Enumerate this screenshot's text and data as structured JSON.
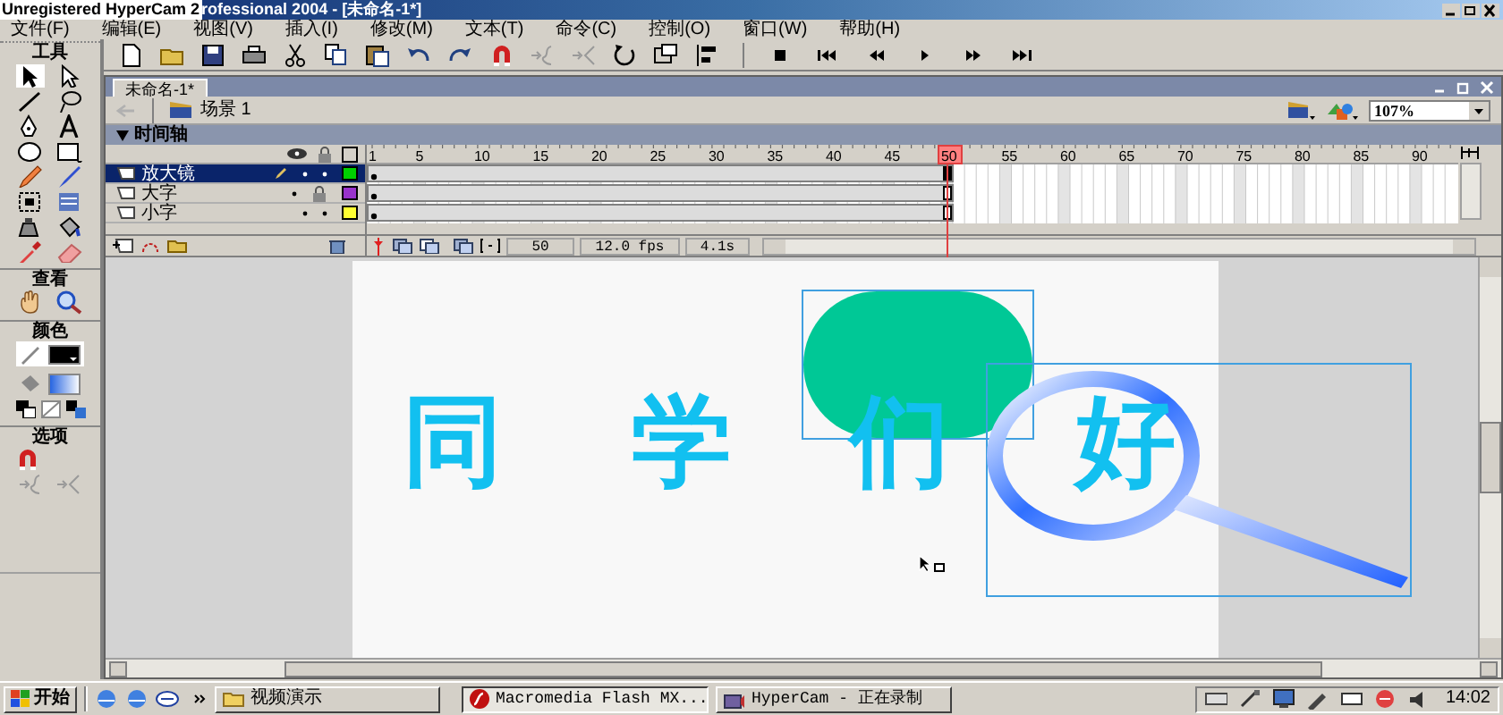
{
  "title_bar": {
    "watermark": "Unregistered HyperCam 2",
    "title": "rofessional 2004 - [未命名-1*]"
  },
  "menu": [
    "文件(F)",
    "编辑(E)",
    "视图(V)",
    "插入(I)",
    "修改(M)",
    "文本(T)",
    "命令(C)",
    "控制(O)",
    "窗口(W)",
    "帮助(H)"
  ],
  "tools_panel": {
    "title": "工具",
    "view_title": "查看",
    "colors_title": "颜色",
    "options_title": "选项"
  },
  "document": {
    "tab": "未命名-1*",
    "scene": "场景 1",
    "zoom": "107%"
  },
  "timeline": {
    "title": "时间轴",
    "ruler": [
      "1",
      "5",
      "10",
      "15",
      "20",
      "25",
      "30",
      "35",
      "40",
      "45",
      "50",
      "55",
      "60",
      "65",
      "70",
      "75",
      "80",
      "85",
      "90"
    ],
    "layers": [
      {
        "name": "放大镜",
        "selected": true,
        "locked": false,
        "color": "#00d000"
      },
      {
        "name": "大字",
        "selected": false,
        "locked": true,
        "color": "#9933cc"
      },
      {
        "name": "小字",
        "selected": false,
        "locked": false,
        "color": "#ffff33"
      }
    ],
    "current_frame": "50",
    "frame_rate": "12.0 fps",
    "elapsed": "4.1s"
  },
  "stage": {
    "words": [
      "同",
      "学",
      "们",
      "好"
    ]
  },
  "taskbar": {
    "start": "开始",
    "items": [
      {
        "label": "视频演示",
        "selected": false,
        "kind": "folder"
      },
      {
        "label": "Macromedia Flash MX...",
        "selected": true,
        "kind": "flash"
      },
      {
        "label": "HyperCam - 正在录制",
        "selected": false,
        "kind": "hypercam"
      }
    ],
    "clock": "14:02"
  }
}
